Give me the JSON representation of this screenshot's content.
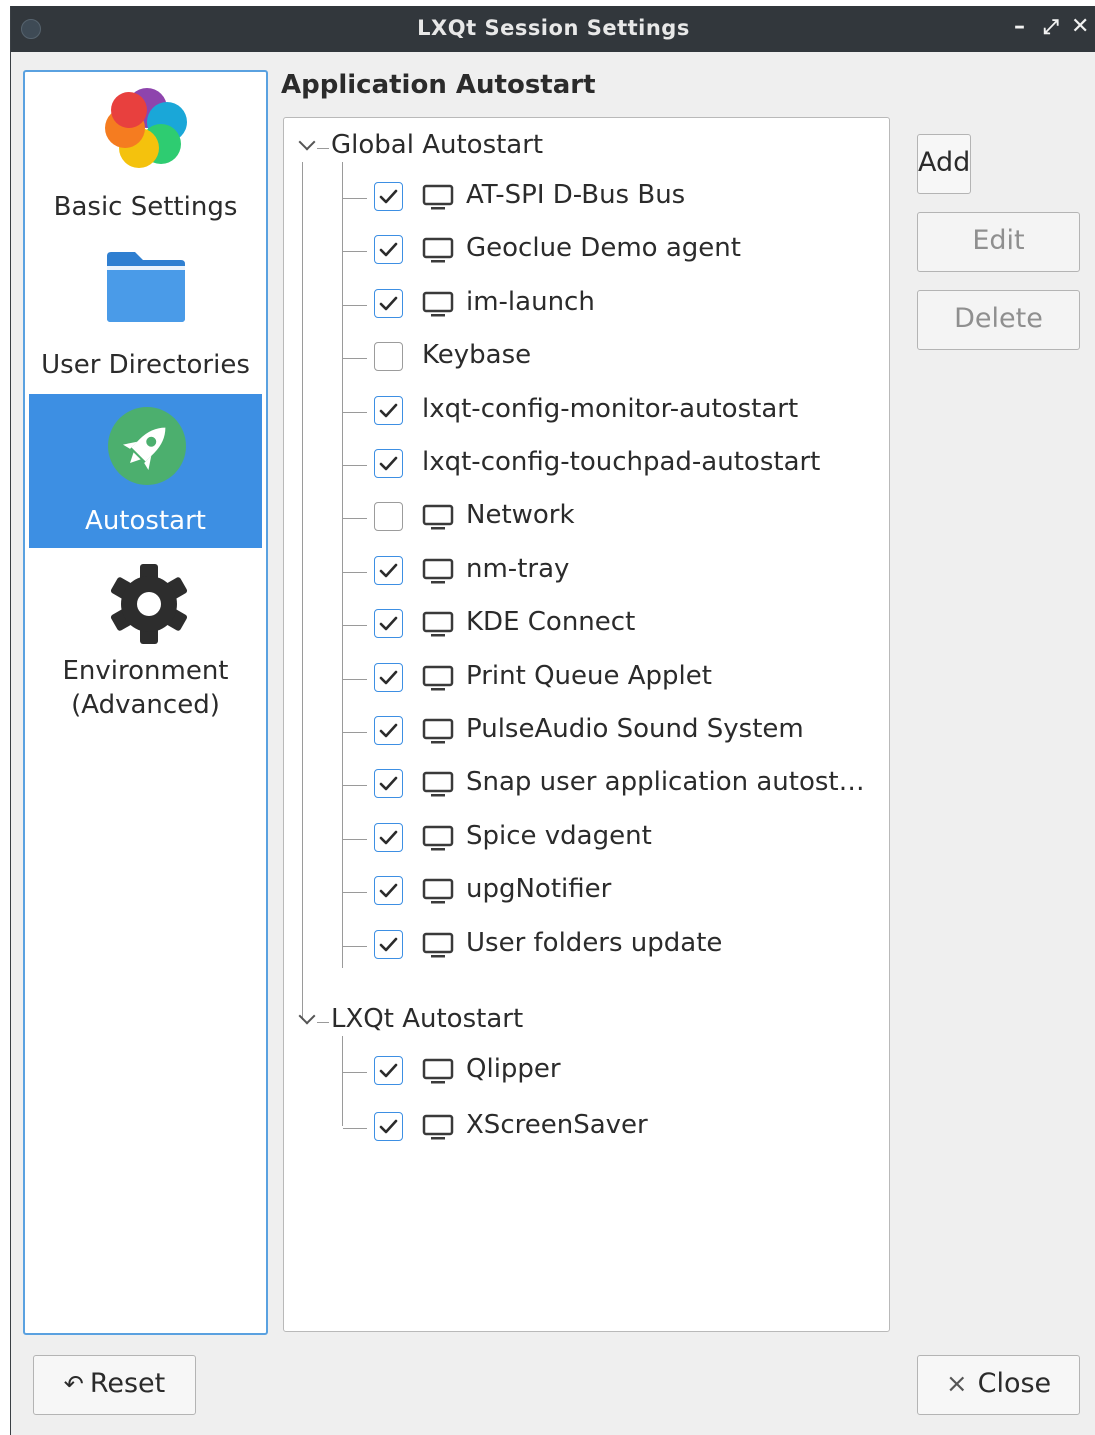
{
  "window": {
    "title": "LXQt Session Settings",
    "minimize_glyph": "–",
    "restore_glyph": "⤢",
    "close_glyph": "✕"
  },
  "sidebar": {
    "items": [
      {
        "label": "Basic Settings",
        "icon": "colorful-flower-icon"
      },
      {
        "label": "User Directories",
        "icon": "folder-icon"
      },
      {
        "label": "Autostart",
        "icon": "rocket-icon",
        "selected": true
      },
      {
        "label_line1": "Environment",
        "label_line2": "(Advanced)",
        "icon": "gear-icon"
      }
    ]
  },
  "main": {
    "heading": "Application Autostart",
    "groups": [
      {
        "label": "Global Autostart",
        "expanded": true,
        "items": [
          {
            "label": "AT-SPI D-Bus Bus",
            "checked": true,
            "icon": true
          },
          {
            "label": "Geoclue Demo agent",
            "checked": true,
            "icon": true
          },
          {
            "label": "im-launch",
            "checked": true,
            "icon": true
          },
          {
            "label": "Keybase",
            "checked": false,
            "icon": false
          },
          {
            "label": "lxqt-config-monitor-autostart",
            "checked": true,
            "icon": false
          },
          {
            "label": "lxqt-config-touchpad-autostart",
            "checked": true,
            "icon": false
          },
          {
            "label": "Network",
            "checked": false,
            "icon": true
          },
          {
            "label": "nm-tray",
            "checked": true,
            "icon": true
          },
          {
            "label": "KDE Connect",
            "checked": true,
            "icon": true
          },
          {
            "label": "Print Queue Applet",
            "checked": true,
            "icon": true
          },
          {
            "label": "PulseAudio Sound System",
            "checked": true,
            "icon": true
          },
          {
            "label": "Snap user application autost…",
            "checked": true,
            "icon": true
          },
          {
            "label": "Spice vdagent",
            "checked": true,
            "icon": true
          },
          {
            "label": "upgNotifier",
            "checked": true,
            "icon": true
          },
          {
            "label": "User folders update",
            "checked": true,
            "icon": true
          }
        ]
      },
      {
        "label": "LXQt Autostart",
        "expanded": true,
        "items": [
          {
            "label": "Qlipper",
            "checked": true,
            "icon": true
          },
          {
            "label": "XScreenSaver",
            "checked": true,
            "icon": true
          }
        ]
      }
    ],
    "buttons": {
      "add": "Add",
      "edit": "Edit",
      "delete": "Delete"
    }
  },
  "footer": {
    "reset_icon": "↶",
    "reset": "Reset",
    "close_icon": "×",
    "close": "Close"
  },
  "colors": {
    "accent": "#3d8fe3",
    "titlebar": "#32373c"
  }
}
